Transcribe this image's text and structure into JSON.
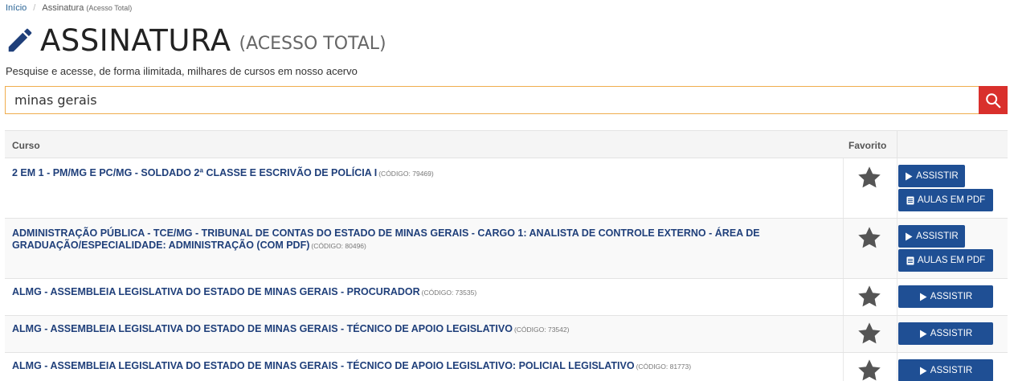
{
  "breadcrumb": {
    "home": "Início",
    "current": "Assinatura",
    "current_detail": "(Acesso Total)"
  },
  "header": {
    "title": "ASSINATURA",
    "subtitle": "(ACESSO TOTAL)",
    "description": "Pesquise e acesse, de forma ilimitada, milhares de cursos em nosso acervo"
  },
  "search": {
    "value": "minas gerais"
  },
  "table": {
    "columns": [
      "Curso",
      "Favorito"
    ],
    "watch_label": "ASSISTIR",
    "pdf_label": "AULAS EM PDF",
    "rows": [
      {
        "title": "2 EM 1 - PM/MG E PC/MG - SOLDADO 2ª CLASSE E ESCRIVÃO DE POLÍCIA I",
        "code": "(CÓDIGO: 79469)"
      },
      {
        "title": "ADMINISTRAÇÃO PÚBLICA - TCE/MG - TRIBUNAL DE CONTAS DO ESTADO DE MINAS GERAIS - CARGO 1: ANALISTA DE CONTROLE EXTERNO - ÁREA DE GRADUAÇÃO/ESPECIALIDADE: ADMINISTRAÇÃO (COM PDF)",
        "code": "(CÓDIGO: 80496)"
      },
      {
        "title": "ALMG - ASSEMBLEIA LEGISLATIVA DO ESTADO DE MINAS GERAIS - PROCURADOR",
        "code": "(CÓDIGO: 73535)"
      },
      {
        "title": "ALMG - ASSEMBLEIA LEGISLATIVA DO ESTADO DE MINAS GERAIS - TÉCNICO DE APOIO LEGISLATIVO",
        "code": "(CÓDIGO: 73542)"
      },
      {
        "title": "ALMG - ASSEMBLEIA LEGISLATIVA DO ESTADO DE MINAS GERAIS - TÉCNICO DE APOIO LEGISLATIVO: POLICIAL LEGISLATIVO",
        "code": "(CÓDIGO: 81773)"
      }
    ]
  },
  "icons": {
    "title": "pencil-icon",
    "search": "search-icon",
    "favorite": "star-icon",
    "watch": "play-icon",
    "pdf": "document-icon"
  },
  "colors": {
    "accent": "#1f4f94",
    "link": "#1f3f7a",
    "search_button": "#d9302c",
    "search_border": "#f0ad4e",
    "star": "#555555"
  }
}
